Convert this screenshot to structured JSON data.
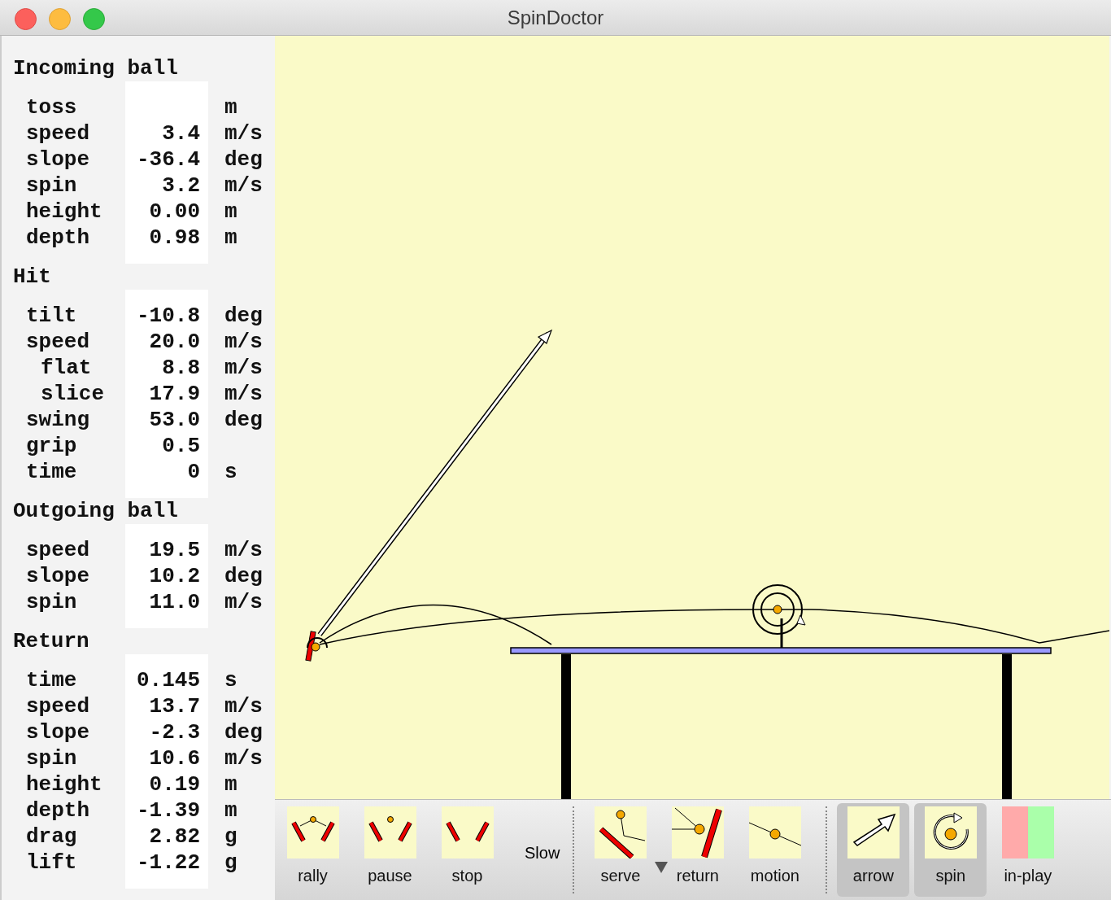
{
  "window": {
    "title": "SpinDoctor"
  },
  "panel": {
    "sections": [
      {
        "title": "Incoming ball",
        "rows": [
          {
            "label": "toss",
            "kind": "main",
            "unit": "m"
          },
          {
            "label": "speed",
            "kind": "main",
            "value": "3.4",
            "unit": "m/s"
          },
          {
            "label": "slope",
            "kind": "main",
            "value": "-36.4",
            "unit": "deg"
          },
          {
            "label": "spin",
            "kind": "main",
            "value": "3.2",
            "unit": "m/s"
          },
          {
            "label": "height",
            "kind": "main",
            "value": "0.00",
            "unit": "m"
          },
          {
            "label": "depth",
            "kind": "main",
            "value": "0.98",
            "unit": "m"
          }
        ]
      },
      {
        "title": "Hit",
        "rows": [
          {
            "label": "tilt",
            "kind": "main",
            "value": "-10.8",
            "unit": "deg"
          },
          {
            "label": "speed",
            "kind": "main",
            "value": "20.0",
            "unit": "m/s"
          },
          {
            "label": "flat",
            "kind": "sub",
            "value": "8.8",
            "unit": "m/s"
          },
          {
            "label": "slice",
            "kind": "sub",
            "value": "17.9",
            "unit": "m/s"
          },
          {
            "label": "swing",
            "kind": "main",
            "value": "53.0",
            "unit": "deg"
          },
          {
            "label": "grip",
            "kind": "main",
            "value": "0.5"
          },
          {
            "label": "time",
            "kind": "main",
            "value": "0",
            "unit": "s"
          }
        ]
      },
      {
        "title": "Outgoing ball",
        "rows": [
          {
            "label": "speed",
            "kind": "main",
            "value": "19.5",
            "unit": "m/s"
          },
          {
            "label": "slope",
            "kind": "main",
            "value": "10.2",
            "unit": "deg"
          },
          {
            "label": "spin",
            "kind": "main",
            "value": "11.0",
            "unit": "m/s"
          }
        ]
      },
      {
        "title": "Return",
        "rows": [
          {
            "label": "time",
            "kind": "main",
            "value": "0.145",
            "unit": "s"
          },
          {
            "label": "speed",
            "kind": "main",
            "value": "13.7",
            "unit": "m/s"
          },
          {
            "label": "slope",
            "kind": "main",
            "value": "-2.3",
            "unit": "deg"
          },
          {
            "label": "spin",
            "kind": "main",
            "value": "10.6",
            "unit": "m/s"
          },
          {
            "label": "height",
            "kind": "main",
            "value": "0.19",
            "unit": "m"
          },
          {
            "label": "depth",
            "kind": "main",
            "value": "-1.39",
            "unit": "m"
          },
          {
            "label": "drag",
            "kind": "main",
            "value": "2.82",
            "unit": "g"
          },
          {
            "label": "lift",
            "kind": "main",
            "value": "-1.22",
            "unit": "g"
          }
        ]
      }
    ]
  },
  "toolbar": {
    "groups": [
      [
        {
          "kind": "tool",
          "label": "rally",
          "pressed": false
        },
        {
          "kind": "tool",
          "label": "pause",
          "pressed": false
        },
        {
          "kind": "tool",
          "label": "stop",
          "pressed": false
        },
        {
          "kind": "text",
          "label": "Slow"
        }
      ],
      [
        {
          "kind": "tool",
          "label": "serve",
          "pressed": false,
          "menu": true
        },
        {
          "kind": "tool",
          "label": "return",
          "pressed": false
        },
        {
          "kind": "tool",
          "label": "motion",
          "pressed": false
        }
      ],
      [
        {
          "kind": "tool",
          "label": "arrow",
          "pressed": true
        },
        {
          "kind": "tool",
          "label": "spin",
          "pressed": true
        },
        {
          "kind": "tool",
          "label": "in-play",
          "pressed": false
        }
      ]
    ]
  }
}
